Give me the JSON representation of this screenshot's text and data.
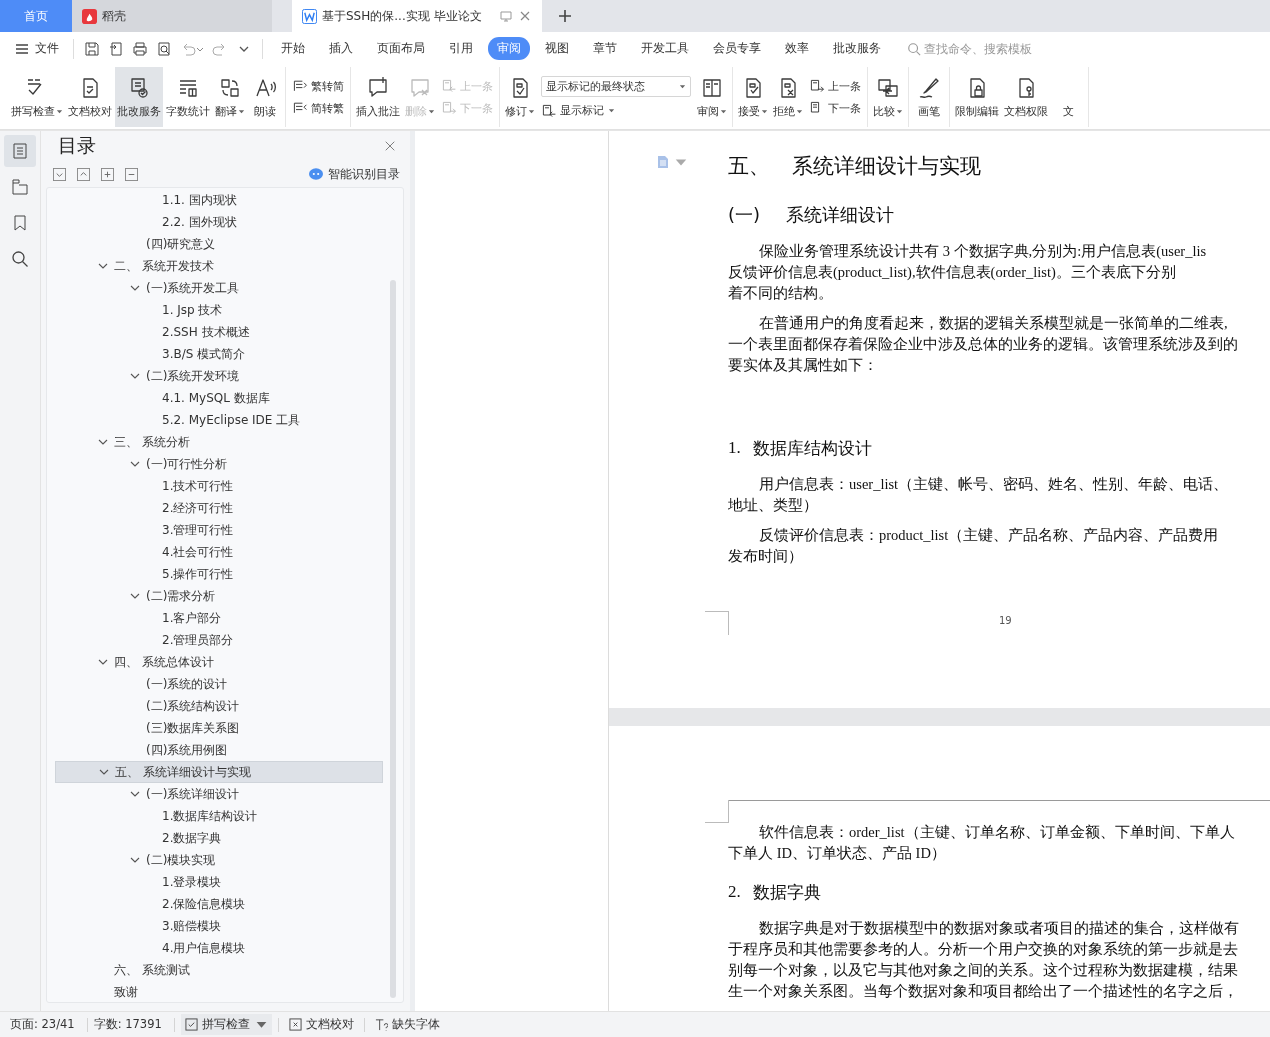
{
  "tabs": [
    {
      "kind": "home",
      "label": "首页",
      "selected": false
    },
    {
      "kind": "docer",
      "label": "稻壳",
      "selected": false
    },
    {
      "kind": "doc",
      "label": "基于SSH的保...实现 毕业论文",
      "selected": true
    }
  ],
  "menu": {
    "file_label": "文件",
    "tabs": [
      {
        "label": "开始",
        "selected": false
      },
      {
        "label": "插入",
        "selected": false
      },
      {
        "label": "页面布局",
        "selected": false
      },
      {
        "label": "引用",
        "selected": false
      },
      {
        "label": "审阅",
        "selected": true
      },
      {
        "label": "视图",
        "selected": false
      },
      {
        "label": "章节",
        "selected": false
      },
      {
        "label": "开发工具",
        "selected": false
      },
      {
        "label": "会员专享",
        "selected": false
      },
      {
        "label": "效率",
        "selected": false
      },
      {
        "label": "批改服务",
        "selected": false
      }
    ],
    "search": {
      "placeholder": "查找命令、搜索模板"
    }
  },
  "ribbon_groups": [
    {
      "tools": [
        {
          "kind": "large",
          "label": "拼写检查",
          "dropdown": true,
          "disabled": false,
          "selected": false
        },
        {
          "kind": "large",
          "label": "文档校对",
          "dropdown": false,
          "disabled": false,
          "selected": false
        },
        {
          "kind": "large",
          "label": "批改服务",
          "dropdown": false,
          "disabled": false,
          "selected": true
        },
        {
          "kind": "large",
          "label": "字数统计",
          "dropdown": false,
          "disabled": false,
          "selected": false
        },
        {
          "kind": "large",
          "label": "翻译",
          "dropdown": true,
          "disabled": false,
          "selected": false
        },
        {
          "kind": "large",
          "label": "朗读",
          "dropdown": false,
          "disabled": false,
          "selected": false
        }
      ]
    },
    {
      "tools": [
        {
          "kind": "stack",
          "items": [
            {
              "kind": "small",
              "label": "繁转简",
              "dropdown": false,
              "disabled": false
            },
            {
              "kind": "small",
              "label": "简转繁",
              "dropdown": false,
              "disabled": false
            }
          ]
        }
      ]
    },
    {
      "tools": [
        {
          "kind": "large",
          "label": "插入批注",
          "dropdown": false,
          "disabled": false,
          "selected": false
        },
        {
          "kind": "large",
          "label": "删除",
          "dropdown": true,
          "disabled": true,
          "selected": false
        },
        {
          "kind": "stack",
          "items": [
            {
              "kind": "small",
              "label": "上一条",
              "dropdown": false,
              "disabled": true
            },
            {
              "kind": "small",
              "label": "下一条",
              "dropdown": false,
              "disabled": true
            }
          ]
        }
      ]
    },
    {
      "tools": [
        {
          "kind": "large",
          "label": "修订",
          "dropdown": true,
          "disabled": false,
          "selected": false
        },
        {
          "kind": "stack",
          "items": [
            {
              "kind": "select",
              "label": "显示标记的最终状态",
              "dropdown": true,
              "disabled": false
            },
            {
              "kind": "small",
              "label": "显示标记",
              "dropdown": true,
              "disabled": false
            }
          ]
        },
        {
          "kind": "large",
          "label": "审阅",
          "dropdown": true,
          "disabled": false,
          "selected": false
        }
      ]
    },
    {
      "tools": [
        {
          "kind": "large",
          "label": "接受",
          "dropdown": true,
          "disabled": false,
          "selected": false
        },
        {
          "kind": "large",
          "label": "拒绝",
          "dropdown": true,
          "disabled": false,
          "selected": false
        },
        {
          "kind": "stack",
          "items": [
            {
              "kind": "small",
              "label": "上一条",
              "dropdown": false,
              "disabled": false
            },
            {
              "kind": "small",
              "label": "下一条",
              "dropdown": false,
              "disabled": false
            }
          ]
        }
      ]
    },
    {
      "tools": [
        {
          "kind": "large",
          "label": "比较",
          "dropdown": true,
          "disabled": false,
          "selected": false
        }
      ]
    },
    {
      "tools": [
        {
          "kind": "large",
          "label": "画笔",
          "dropdown": false,
          "disabled": false,
          "selected": false
        }
      ]
    },
    {
      "tools": [
        {
          "kind": "large",
          "label": "限制编辑",
          "dropdown": false,
          "disabled": false,
          "selected": false
        },
        {
          "kind": "large",
          "label": "文档权限",
          "dropdown": false,
          "disabled": false,
          "selected": false
        },
        {
          "kind": "large",
          "label": "文",
          "dropdown": false,
          "disabled": false,
          "selected": false
        }
      ]
    }
  ],
  "side_strip": [
    {
      "selected": true
    },
    {
      "selected": false
    },
    {
      "selected": false
    },
    {
      "selected": false
    }
  ],
  "toc": {
    "title": "目录",
    "smart_label": "智能识别目录",
    "items": [
      {
        "children": [
          {
            "children": [
              {
                "label": "1.1.  国内现状",
                "selected": false
              },
              {
                "label": "2.2.  国外现状",
                "selected": false
              }
            ]
          },
          {
            "label": "(四)研究意义",
            "selected": false
          }
        ]
      },
      {
        "label": "二、 系统开发技术",
        "selected": false,
        "expanded": true,
        "children": [
          {
            "label": "(一)系统开发工具",
            "selected": false,
            "expanded": true,
            "children": [
              {
                "label": "1.  Jsp 技术",
                "selected": false
              },
              {
                "label": "2.SSH 技术概述",
                "selected": false
              },
              {
                "label": "3.B/S 模式简介",
                "selected": false
              }
            ]
          },
          {
            "label": "(二)系统开发环境",
            "selected": false,
            "expanded": true,
            "children": [
              {
                "label": "4.1. MySQL 数据库",
                "selected": false
              },
              {
                "label": "5.2. MyEclipse IDE 工具",
                "selected": false
              }
            ]
          }
        ]
      },
      {
        "label": "三、 系统分析",
        "selected": false,
        "expanded": true,
        "children": [
          {
            "label": "(一)可行性分析",
            "selected": false,
            "expanded": true,
            "children": [
              {
                "label": "1.技术可行性",
                "selected": false
              },
              {
                "label": "2.经济可行性",
                "selected": false
              },
              {
                "label": "3.管理可行性",
                "selected": false
              },
              {
                "label": "4.社会可行性",
                "selected": false
              },
              {
                "label": "5.操作可行性",
                "selected": false
              }
            ]
          },
          {
            "label": "(二)需求分析",
            "selected": false,
            "expanded": true,
            "children": [
              {
                "label": "1.客户部分",
                "selected": false
              },
              {
                "label": "2.管理员部分",
                "selected": false
              }
            ]
          }
        ]
      },
      {
        "label": "四、 系统总体设计",
        "selected": false,
        "expanded": true,
        "children": [
          {
            "label": "(一)系统的设计",
            "selected": false
          },
          {
            "label": "(二)系统结构设计",
            "selected": false
          },
          {
            "label": "(三)数据库关系图",
            "selected": false
          },
          {
            "label": "(四)系统用例图",
            "selected": false
          }
        ]
      },
      {
        "label": "五、 系统详细设计与实现",
        "selected": true,
        "expanded": true,
        "children": [
          {
            "label": "(一)系统详细设计",
            "selected": false,
            "expanded": true,
            "children": [
              {
                "label": "1.数据库结构设计",
                "selected": false
              },
              {
                "label": "2.数据字典",
                "selected": false
              }
            ]
          },
          {
            "label": "(二)模块实现",
            "selected": false,
            "expanded": true,
            "children": [
              {
                "label": "1.登录模块",
                "selected": false
              },
              {
                "label": "2.保险信息模块",
                "selected": false
              },
              {
                "label": "3.赔偿模块",
                "selected": false
              },
              {
                "label": "4.用户信息模块",
                "selected": false
              }
            ]
          }
        ]
      },
      {
        "label": "六、 系统测试",
        "selected": false
      },
      {
        "label": "致谢",
        "selected": false
      }
    ]
  },
  "document": {
    "pages": [
      {
        "page_number": "19",
        "blocks": [
          {
            "kind": "h1",
            "number": "五、",
            "text": "系统详细设计与实现"
          },
          {
            "kind": "h2",
            "number": "(一)",
            "text": "系统详细设计"
          },
          {
            "kind": "para",
            "lines": [
              "保险业务管理系统设计共有 3 个数据字典,分别为:用户信息表(user_lis",
              "反馈评价信息表(product_list),软件信息表(order_list)。三个表底下分别",
              "着不同的结构。"
            ]
          },
          {
            "kind": "para",
            "lines": [
              "在普通用户的角度看起来，数据的逻辑关系模型就是一张简单的二维表,",
              "一个表里面都保存着保险企业中涉及总体的业务的逻辑。该管理系统涉及到的",
              "要实体及其属性如下："
            ]
          },
          {
            "kind": "h3",
            "number": "1.",
            "text": "数据库结构设计"
          },
          {
            "kind": "para",
            "lines": [
              "用户信息表：user_list（主键、帐号、密码、姓名、性别、年龄、电话、",
              "地址、类型）"
            ]
          },
          {
            "kind": "para",
            "lines": [
              "反馈评价信息表：product_list（主键、产品名称、产品内容、产品费用",
              "发布时间）"
            ]
          }
        ]
      },
      {
        "blocks": [
          {
            "kind": "para",
            "lines": [
              "软件信息表：order_list（主键、订单名称、订单金额、下单时间、下单人",
              "下单人 ID、订单状态、产品 ID）"
            ]
          },
          {
            "kind": "h3",
            "number": "2.",
            "text": "数据字典"
          },
          {
            "kind": "para",
            "lines": [
              "数据字典是对于数据模型中的数据对象或者项目的描述的集合，这样做有",
              "于程序员和其他需要参考的人。分析一个用户交换的对象系统的第一步就是去",
              "别每一个对象，以及它与其他对象之间的关系。这个过程称为数据建模，结果",
              "生一个对象关系图。当每个数据对象和项目都给出了一个描述性的名字之后，"
            ]
          }
        ]
      }
    ]
  },
  "status_bar": {
    "page": "页面: 23/41",
    "words": "字数: 17391",
    "spell": "拼写检查",
    "proof": "文档校对",
    "fonts": "缺失字体"
  }
}
